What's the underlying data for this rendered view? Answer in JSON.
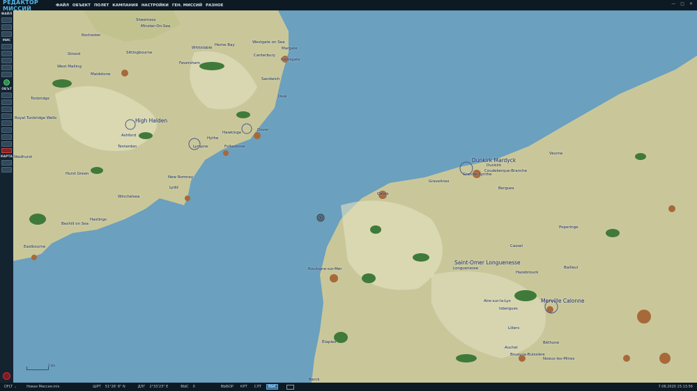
{
  "app": {
    "title": "РЕДАКТОР МИССИЙ"
  },
  "menu": [
    "ФАЙЛ",
    "ОБЪЕКТ",
    "ПОЛЕТ",
    "КАМПАНИЯ",
    "НАСТРОЙКИ",
    "ГЕН. МИССИЙ",
    "РАЗНОЕ"
  ],
  "window_controls": {
    "minimize": "—",
    "maximize": "□",
    "close": "✕"
  },
  "sidebar": {
    "sections": [
      {
        "label": "ФАЙЛ",
        "buttons": 3
      },
      {
        "label": "МИС",
        "buttons": 6
      },
      {
        "label": "ОБЪТ",
        "buttons": 9
      },
      {
        "label": "КАРТА",
        "buttons": 2
      }
    ]
  },
  "map": {
    "labels": [
      {
        "text": "Sheerness",
        "big": false
      },
      {
        "text": "Minster-On-Sea",
        "big": false
      },
      {
        "text": "Rochester",
        "big": false
      },
      {
        "text": "Strood",
        "big": false
      },
      {
        "text": "Sittingbourne",
        "big": false
      },
      {
        "text": "Whitstable",
        "big": false
      },
      {
        "text": "Herne Bay",
        "big": false
      },
      {
        "text": "Westgate on Sea",
        "big": false
      },
      {
        "text": "Margate",
        "big": false
      },
      {
        "text": "Ramsgate",
        "big": false
      },
      {
        "text": "Faversham",
        "big": false
      },
      {
        "text": "West Malling",
        "big": false
      },
      {
        "text": "Maidstone",
        "big": false
      },
      {
        "text": "Canterbury",
        "big": false
      },
      {
        "text": "Sandwich",
        "big": false
      },
      {
        "text": "Deal",
        "big": false
      },
      {
        "text": "Tonbridge",
        "big": false
      },
      {
        "text": "Royal Tunbridge Wells",
        "big": false
      },
      {
        "text": "High Halden",
        "big": true
      },
      {
        "text": "Ashford",
        "big": false
      },
      {
        "text": "Hawkinge",
        "big": false
      },
      {
        "text": "Dover",
        "big": false
      },
      {
        "text": "Lympne",
        "big": false
      },
      {
        "text": "Hythe",
        "big": false
      },
      {
        "text": "Folkestone",
        "big": false
      },
      {
        "text": "Tenterden",
        "big": false
      },
      {
        "text": "Wadhurst",
        "big": false
      },
      {
        "text": "Hurst Green",
        "big": false
      },
      {
        "text": "New Romney",
        "big": false
      },
      {
        "text": "Lydd",
        "big": false
      },
      {
        "text": "Winchelsea",
        "big": false
      },
      {
        "text": "Hastings",
        "big": false
      },
      {
        "text": "Bexhill on Sea",
        "big": false
      },
      {
        "text": "Eastbourne",
        "big": false
      },
      {
        "text": "Dunkirk Mardyck",
        "big": true
      },
      {
        "text": "Dunkirk",
        "big": false
      },
      {
        "text": "Coudekerque-Branche",
        "big": false
      },
      {
        "text": "Grande-Synthe",
        "big": false
      },
      {
        "text": "Gravelines",
        "big": false
      },
      {
        "text": "Calais",
        "big": false
      },
      {
        "text": "Bergues",
        "big": false
      },
      {
        "text": "Veurne",
        "big": false
      },
      {
        "text": "Poperinge",
        "big": false
      },
      {
        "text": "Cassel",
        "big": false
      },
      {
        "text": "Saint-Omer Longuenesse",
        "big": true
      },
      {
        "text": "Longuenesse",
        "big": false
      },
      {
        "text": "Hazebrouck",
        "big": false
      },
      {
        "text": "Bailleul",
        "big": false
      },
      {
        "text": "Boulogne-sur-Mer",
        "big": false
      },
      {
        "text": "Aire-sur-la-Lys",
        "big": false
      },
      {
        "text": "Isbergues",
        "big": false
      },
      {
        "text": "Merville Calonne",
        "big": true
      },
      {
        "text": "Lillers",
        "big": false
      },
      {
        "text": "Béthune",
        "big": false
      },
      {
        "text": "Auchel",
        "big": false
      },
      {
        "text": "Bruay-la-Buissière",
        "big": false
      },
      {
        "text": "Noeux-les-Mines",
        "big": false
      },
      {
        "text": "Étaples",
        "big": false
      },
      {
        "text": "Berck",
        "big": false
      }
    ],
    "scale_text": "5 km",
    "colors": {
      "sea": "#6ba0be",
      "land": "#c9c79a",
      "forest": "#3f7a3a",
      "town": "#a8693a"
    }
  },
  "status": {
    "profile": "DFLT",
    "mission": "Новая Миссия.mis",
    "lat_label": "ШРТ",
    "lat": "51°26' 8\" N",
    "lon_label": "ДЛГ",
    "lon": "2°33'23\" E",
    "alt_label": "ВЫС",
    "alt": "0",
    "modes": [
      "ВЫБОР",
      "КРТ",
      "СЛТ",
      "ВЫС"
    ],
    "active_mode": 3,
    "datetime": "7.08.2020 15:13:56"
  }
}
